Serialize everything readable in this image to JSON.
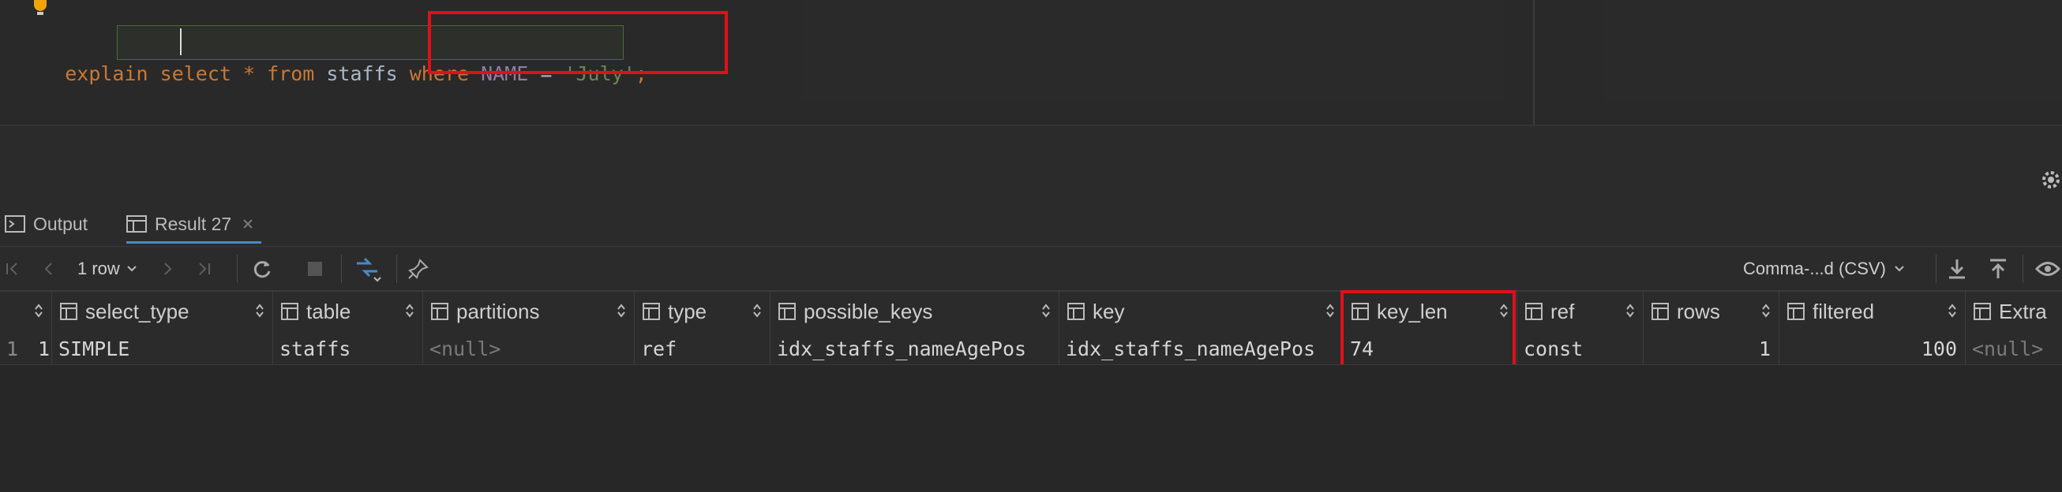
{
  "editor": {
    "tokens": [
      {
        "text": "explain",
        "cls": "kw"
      },
      {
        "text": " ",
        "cls": "op"
      },
      {
        "text": "select",
        "cls": "kw"
      },
      {
        "text": " * ",
        "cls": "kw"
      },
      {
        "text": "from",
        "cls": "kw"
      },
      {
        "text": " staffs ",
        "cls": "id"
      },
      {
        "text": "where",
        "cls": "kw"
      },
      {
        "text": " ",
        "cls": "op"
      },
      {
        "text": "NAME",
        "cls": "col"
      },
      {
        "text": " = ",
        "cls": "op"
      },
      {
        "text": "'July'",
        "cls": "str"
      },
      {
        "text": ";",
        "cls": "kw"
      }
    ]
  },
  "panel": {
    "tabs": [
      {
        "label": "Output"
      },
      {
        "label": "Result 27"
      }
    ]
  },
  "toolbar": {
    "row_count": "1 row",
    "export_format": "Comma-...d (CSV)"
  },
  "table": {
    "row_number": "1",
    "columns": [
      "select_type",
      "table",
      "partitions",
      "type",
      "possible_keys",
      "key",
      "key_len",
      "ref",
      "rows",
      "filtered",
      "Extra"
    ],
    "id_value": "1",
    "row": [
      "SIMPLE",
      "staffs",
      "<null>",
      "ref",
      "idx_staffs_nameAgePos",
      "idx_staffs_nameAgePos",
      "74",
      "const",
      "1",
      "100",
      "<null>"
    ]
  },
  "colors": {
    "keyword": "#cc7832",
    "column": "#9876aa",
    "string": "#6a8759",
    "highlight": "#e0101a",
    "accent": "#4a88c7"
  }
}
